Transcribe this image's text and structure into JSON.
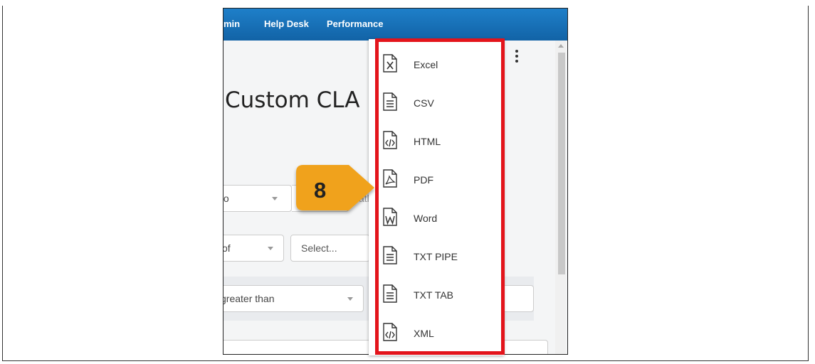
{
  "top_caption": "",
  "navbar": {
    "items": [
      {
        "label": "min"
      },
      {
        "label": "Help Desk"
      },
      {
        "label": "Performance"
      }
    ]
  },
  "page": {
    "title": "Custom CLA",
    "filters": {
      "row1_left": "to",
      "row1_right": "atl",
      "row2_left": "of",
      "row2_right": "Select...",
      "row3_left": "greater than"
    }
  },
  "export_menu": {
    "items": [
      {
        "label": "Excel",
        "icon": "excel-file-icon"
      },
      {
        "label": "CSV",
        "icon": "csv-file-icon"
      },
      {
        "label": "HTML",
        "icon": "html-file-icon"
      },
      {
        "label": "PDF",
        "icon": "pdf-file-icon"
      },
      {
        "label": "Word",
        "icon": "word-file-icon"
      },
      {
        "label": "TXT PIPE",
        "icon": "text-file-icon"
      },
      {
        "label": "TXT TAB",
        "icon": "text-file-icon"
      },
      {
        "label": "XML",
        "icon": "xml-file-icon"
      }
    ]
  },
  "callout": {
    "number": "8",
    "color": "#f0a21b"
  },
  "highlight_color": "#e3141b"
}
